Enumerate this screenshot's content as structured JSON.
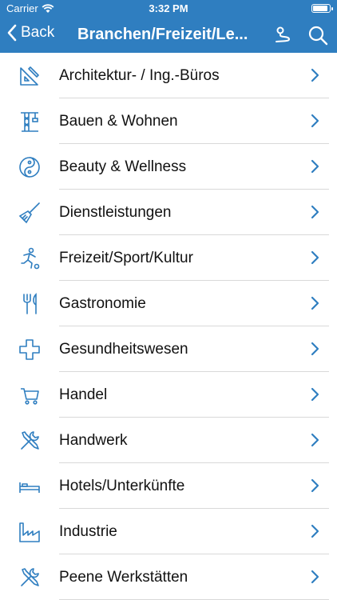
{
  "status_bar": {
    "carrier": "Carrier",
    "time": "3:32 PM"
  },
  "nav": {
    "back_label": "Back",
    "title": "Branchen/Freizeit/Le...",
    "map_icon": "route-icon",
    "search_icon": "search-icon"
  },
  "colors": {
    "header": "#2f7ec0",
    "accent": "#2f7ec0"
  },
  "categories": [
    {
      "label": "Architektur- / Ing.-Büros",
      "icon": "drafting-tools-icon"
    },
    {
      "label": "Bauen & Wohnen",
      "icon": "construction-crane-icon"
    },
    {
      "label": "Beauty & Wellness",
      "icon": "yin-yang-icon"
    },
    {
      "label": "Dienstleistungen",
      "icon": "broom-icon"
    },
    {
      "label": "Freizeit/Sport/Kultur",
      "icon": "soccer-player-icon"
    },
    {
      "label": "Gastronomie",
      "icon": "fork-knife-icon"
    },
    {
      "label": "Gesundheitswesen",
      "icon": "medical-cross-icon"
    },
    {
      "label": "Handel",
      "icon": "shopping-cart-icon"
    },
    {
      "label": "Handwerk",
      "icon": "wrench-screwdriver-icon"
    },
    {
      "label": "Hotels/Unterkünfte",
      "icon": "bed-icon"
    },
    {
      "label": "Industrie",
      "icon": "factory-icon"
    },
    {
      "label": "Peene Werkstätten",
      "icon": "wrench-screwdriver-icon"
    }
  ]
}
